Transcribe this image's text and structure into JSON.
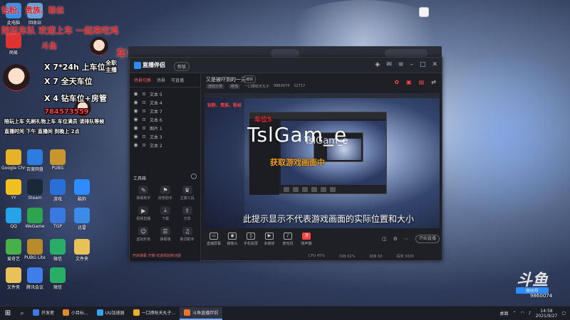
{
  "overlay": {
    "line1": "钻粉、贵族、粉丝",
    "line2": "陪玩车队 欢迎上车 一起来吃鸡",
    "line3": "斗鱼",
    "car_position": "车位5",
    "white1": "X 7*24h 上车位",
    "white2": "X 7 全天车位",
    "white3": "X 4 钻车位+房管",
    "qq_number": "784573559",
    "live_label": "全职主播",
    "note1": "陪玩上车 先刷礼物上车 车位满员 请排队等候",
    "note2": "直播时间 下午 直播间 到晚上 2点"
  },
  "desktop_icons": [
    {
      "label": "此电脑",
      "color": "#3f8de0"
    },
    {
      "label": "回收站",
      "color": "#6aa0d8"
    },
    {
      "label": "网易",
      "color": "#d33"
    },
    {
      "label": "Google Chrome",
      "color": "#e5b22a"
    },
    {
      "label": "百度网盘",
      "color": "#2d7de0"
    },
    {
      "label": "PUBG",
      "color": "#c7962e"
    },
    {
      "label": "YY",
      "color": "#f0c020"
    },
    {
      "label": "Steam",
      "color": "#1b2838"
    },
    {
      "label": "游戏",
      "color": "#2a6fd8"
    },
    {
      "label": "酷狗",
      "color": "#2f8cff"
    },
    {
      "label": "QQ",
      "color": "#29a3e8"
    },
    {
      "label": "WeGame",
      "color": "#2fa44f"
    },
    {
      "label": "TGP",
      "color": "#3a79e0"
    },
    {
      "label": "迅雷",
      "color": "#3d8be8"
    },
    {
      "label": "爱奇艺",
      "color": "#47b04b"
    },
    {
      "label": "PUBG Lite",
      "color": "#b88c2c"
    },
    {
      "label": "微信",
      "color": "#2aae67"
    },
    {
      "label": "文件夹",
      "color": "#e8c15a"
    },
    {
      "label": "文件夹",
      "color": "#e8c15a"
    },
    {
      "label": "腾讯会议",
      "color": "#3f7ee8"
    },
    {
      "label": "微信",
      "color": "#2aae67"
    }
  ],
  "app": {
    "logo_text": "直播伴侣",
    "version_badge": "新版",
    "titlebar_icons": [
      "skin-icon",
      "mail-icon",
      "menu-icon",
      "minimize-icon",
      "maximize-icon",
      "close-icon"
    ],
    "left_tabs": [
      "场景切换",
      "场景",
      "可直播"
    ],
    "scene_items": [
      "文本 5",
      "文本 4",
      "文本 7",
      "文本 6",
      "图片 1",
      "文本 3",
      "文本 2"
    ],
    "tools_title": "工具箱",
    "tools": [
      {
        "label": "弹幕助手",
        "glyph": "✎"
      },
      {
        "label": "房管助手",
        "glyph": "⚑"
      },
      {
        "label": "主播工具",
        "glyph": "♛"
      },
      {
        "label": "视频直播",
        "glyph": "▶"
      },
      {
        "label": "下载",
        "glyph": "⤓"
      },
      {
        "label": "分享",
        "glyph": "⇪"
      },
      {
        "label": "虚拟形象",
        "glyph": "☺"
      },
      {
        "label": "弹幕墙",
        "glyph": "☰"
      },
      {
        "label": "歌词助手",
        "glyph": "♫"
      }
    ],
    "stream_title": "又是被吓到的一天",
    "edit_label": "编辑",
    "stream_meta": [
      "游戏分类",
      "绝地",
      "一口撩秋天丸子",
      "9860074",
      "12717"
    ],
    "main_icons": [
      "gift-icon",
      "wallet-icon",
      "tv-icon",
      "share-icon"
    ],
    "preview": {
      "watermark": "TslGam_e",
      "watermark2": "TslGam_e",
      "orange_caption": "获取游戏画面中",
      "caption": "此提示显示不代表游戏画面的实际位置和大小",
      "small_red": "钻粉、贵族、粉丝",
      "car_label": "车位5"
    },
    "controls": [
      {
        "label": "直播屏幕",
        "glyph": "▭"
      },
      {
        "label": "摄像头",
        "glyph": "◉"
      },
      {
        "label": "手机投屏",
        "glyph": "▯"
      },
      {
        "label": "多媒体",
        "glyph": "▶"
      },
      {
        "label": "麦克风",
        "glyph": "♪"
      },
      {
        "label": "扬声器",
        "glyph": "♬"
      }
    ],
    "start_live": "开始直播",
    "left_status": "开启弹幕 开播 欢迎体验新功能",
    "status_items": [
      "CPU 45%",
      "内存 62%",
      "帧率 60",
      "码率 3000"
    ]
  },
  "bottom_right": {
    "logo_mark": "斗鱼",
    "logo_tag": "房间号",
    "room_id": "9860074"
  },
  "taskbar": {
    "start": "⊞",
    "search": "⌕",
    "apps": [
      {
        "label": "开发者",
        "color": "#3d7be0",
        "active": false
      },
      {
        "label": "小目标...",
        "color": "#e08a2f",
        "active": false
      },
      {
        "label": "UU加速器",
        "color": "#35a1f0",
        "active": false
      },
      {
        "label": "一口撩秋天丸子...",
        "color": "#e5b22a",
        "active": false
      },
      {
        "label": "斗鱼直播伴侣",
        "color": "#f0732a",
        "active": true
      }
    ],
    "tray_text": "桌面",
    "time": "14:58",
    "date": "2021/9/27"
  }
}
